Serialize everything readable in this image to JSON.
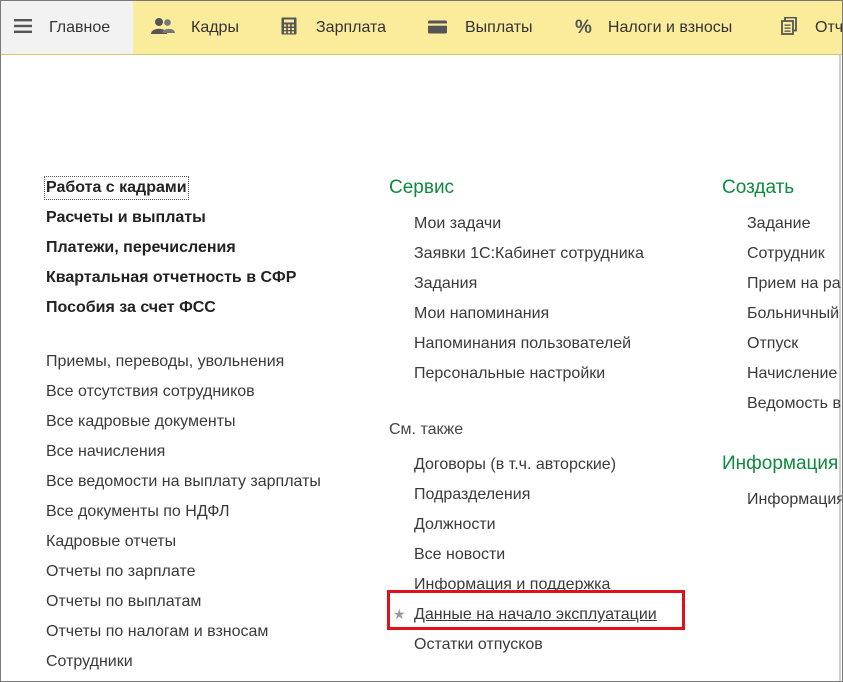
{
  "tabs": [
    {
      "label": "Главное",
      "icon": "menu-icon",
      "active": true
    },
    {
      "label": "Кадры",
      "icon": "people-icon"
    },
    {
      "label": "Зарплата",
      "icon": "calculator-icon"
    },
    {
      "label": "Выплаты",
      "icon": "wallet-icon"
    },
    {
      "label": "Налоги и взносы",
      "icon": "percent-icon"
    },
    {
      "label": "Отч",
      "icon": "reports-icon"
    }
  ],
  "left": {
    "bold": [
      "Работа с кадрами",
      "Расчеты и выплаты",
      "Платежи, перечисления",
      "Квартальная отчетность в СФР",
      "Пособия за счет ФСС"
    ],
    "items": [
      "Приемы, переводы, увольнения",
      "Все отсутствия сотрудников",
      "Все кадровые документы",
      "Все начисления",
      "Все ведомости на выплату зарплаты",
      "Все документы по НДФЛ",
      "Кадровые отчеты",
      "Отчеты по зарплате",
      "Отчеты по выплатам",
      "Отчеты по налогам и взносам",
      "Сотрудники"
    ]
  },
  "middle": {
    "service_title": "Сервис",
    "service_items": [
      "Мои задачи",
      "Заявки 1С:Кабинет сотрудника",
      "Задания",
      "Мои напоминания",
      "Напоминания пользователей",
      "Персональные настройки"
    ],
    "see_also_title": "См. также",
    "see_also_items": [
      "Договоры (в т.ч. авторские)",
      "Подразделения",
      "Должности",
      "Все новости",
      "Информация и поддержка",
      "Данные на начало эксплуатации",
      "Остатки отпусков"
    ],
    "highlighted_item": "Данные на начало эксплуатации",
    "star_icon": "star-icon"
  },
  "right": {
    "create_title": "Создать",
    "create_items": [
      "Задание",
      "Сотрудник",
      "Прием на ра",
      "Больничный",
      "Отпуск",
      "Начисление",
      "Ведомость в"
    ],
    "info_title": "Информация",
    "info_items": [
      "Информация"
    ]
  },
  "colors": {
    "topbar": "#fbec9c",
    "active_tab": "#f2f2f2",
    "section_green": "#0f8a3c",
    "highlight_red": "#e0101a"
  }
}
